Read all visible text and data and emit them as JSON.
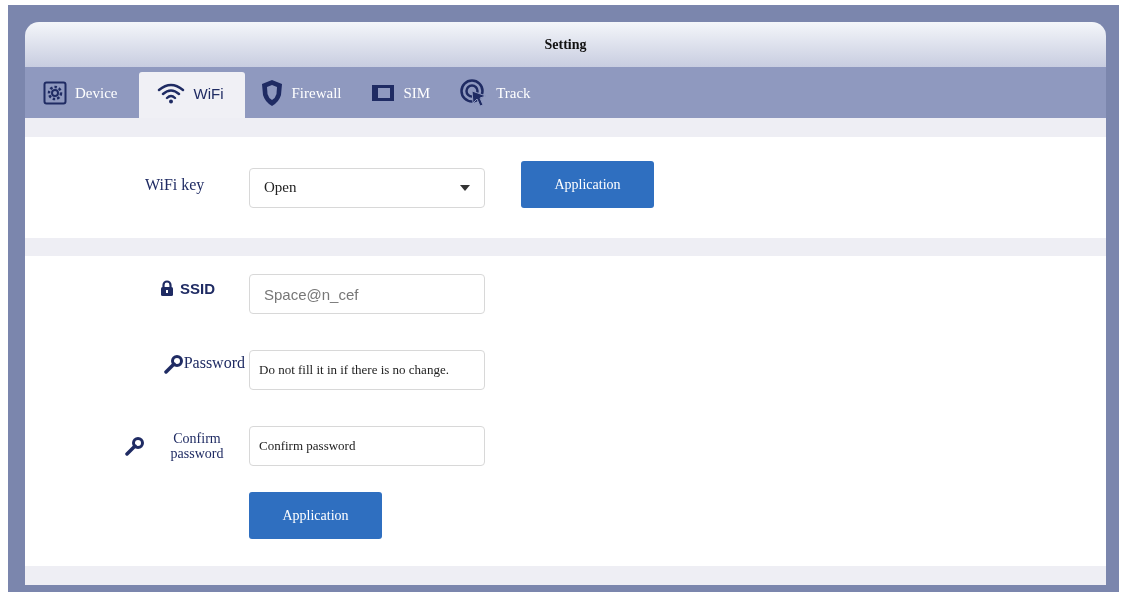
{
  "window": {
    "title": "Setting"
  },
  "tabs": [
    {
      "label": "Device",
      "selected": false
    },
    {
      "label": "WiFi",
      "selected": true
    },
    {
      "label": "Firewall",
      "selected": false
    },
    {
      "label": "SIM",
      "selected": false
    },
    {
      "label": "Track",
      "selected": false
    }
  ],
  "key_section": {
    "label": "WiFi key",
    "select": {
      "value": "Open"
    },
    "button": "Application"
  },
  "form": {
    "fields": [
      {
        "label": "SSID",
        "value": "Space@n_cef"
      },
      {
        "label": "Password",
        "placeholder": "Do not fill it in if there is no change."
      },
      {
        "label": "Confirm password",
        "placeholder": "Confirm password"
      }
    ],
    "button": "Application"
  }
}
